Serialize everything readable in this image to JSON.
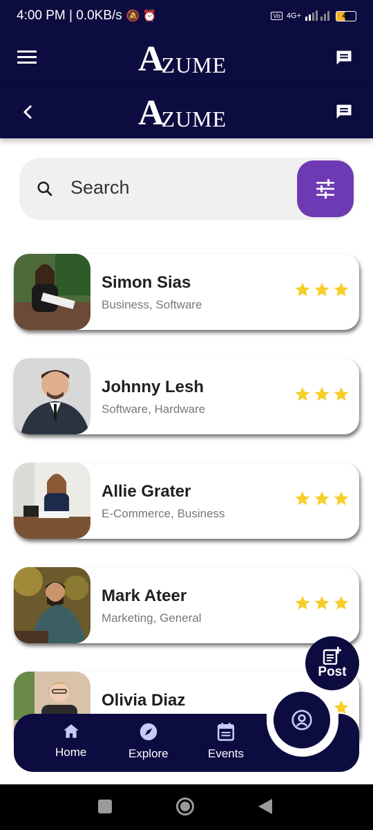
{
  "status_bar": {
    "time": "4:00 PM | 0.0KB/s",
    "battery": "48",
    "network": "4G+"
  },
  "app": {
    "logo_a": "A",
    "logo_rest": "ZUME"
  },
  "search": {
    "placeholder": "Search"
  },
  "people": [
    {
      "name": "Simon Sias",
      "tags": "Business, Software",
      "rating": 3
    },
    {
      "name": "Johnny Lesh",
      "tags": "Software, Hardware",
      "rating": 3
    },
    {
      "name": "Allie Grater",
      "tags": "E-Commerce, Business",
      "rating": 3
    },
    {
      "name": "Mark Ateer",
      "tags": "Marketing, General",
      "rating": 3
    },
    {
      "name": "Olivia Diaz",
      "tags": "",
      "rating": 1
    }
  ],
  "post_fab": {
    "label": "Post"
  },
  "nav": [
    {
      "label": "Home",
      "icon": "home-icon"
    },
    {
      "label": "Explore",
      "icon": "compass-icon"
    },
    {
      "label": "Events",
      "icon": "calendar-icon"
    }
  ],
  "colors": {
    "primary": "#0c0c40",
    "accent": "#6e3ab3",
    "star": "#f7cf2a"
  }
}
